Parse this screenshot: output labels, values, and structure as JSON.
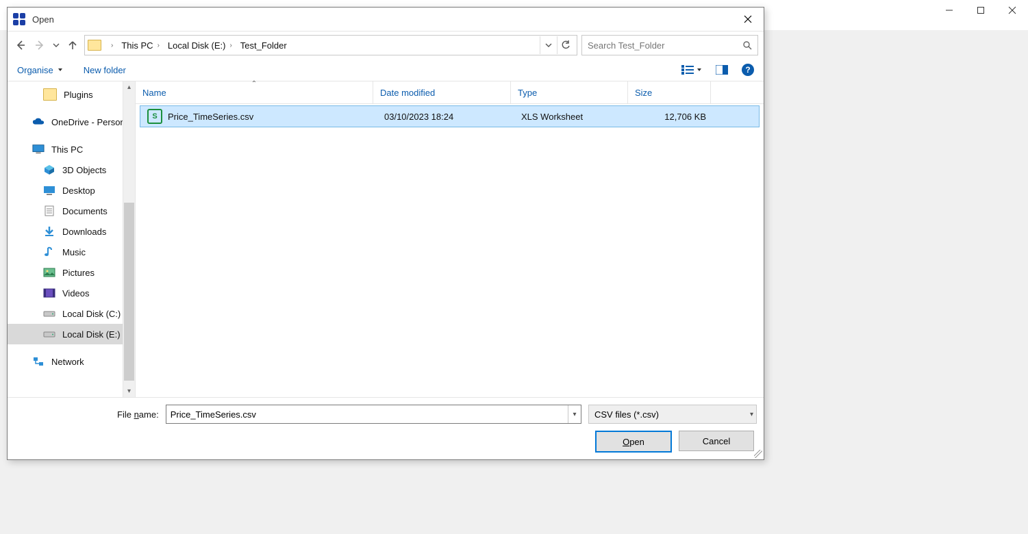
{
  "outer_window": {
    "controls": {
      "min": "–",
      "max": "▢",
      "close": "✕"
    }
  },
  "dialog": {
    "title": "Open",
    "close": "✕"
  },
  "breadcrumb": {
    "items": [
      "This PC",
      "Local Disk (E:)",
      "Test_Folder"
    ]
  },
  "search": {
    "placeholder": "Search Test_Folder"
  },
  "toolbar": {
    "organise": "Organise",
    "new_folder": "New folder"
  },
  "tree": {
    "items": [
      {
        "label": "Plugins",
        "level": 1,
        "icon": "folder"
      },
      {
        "label": "OneDrive - Personal",
        "level": 0,
        "icon": "cloud"
      },
      {
        "label": "This PC",
        "level": 0,
        "icon": "pc"
      },
      {
        "label": "3D Objects",
        "level": 1,
        "icon": "3d"
      },
      {
        "label": "Desktop",
        "level": 1,
        "icon": "desktop"
      },
      {
        "label": "Documents",
        "level": 1,
        "icon": "doc"
      },
      {
        "label": "Downloads",
        "level": 1,
        "icon": "down"
      },
      {
        "label": "Music",
        "level": 1,
        "icon": "music"
      },
      {
        "label": "Pictures",
        "level": 1,
        "icon": "pic"
      },
      {
        "label": "Videos",
        "level": 1,
        "icon": "vid"
      },
      {
        "label": "Local Disk (C:)",
        "level": 1,
        "icon": "disk"
      },
      {
        "label": "Local Disk (E:)",
        "level": 1,
        "icon": "disk",
        "selected": true
      },
      {
        "label": "Network",
        "level": 0,
        "icon": "net"
      }
    ]
  },
  "columns": {
    "name": "Name",
    "date": "Date modified",
    "type": "Type",
    "size": "Size"
  },
  "files": [
    {
      "name": "Price_TimeSeries.csv",
      "date": "03/10/2023 18:24",
      "type": "XLS Worksheet",
      "size": "12,706 KB",
      "icon_letter": "S",
      "selected": true
    }
  ],
  "bottom": {
    "file_name_label_pre": "File ",
    "file_name_label_u": "n",
    "file_name_label_post": "ame:",
    "file_name_value": "Price_TimeSeries.csv",
    "filter": "CSV files (*.csv)",
    "open_pre": "",
    "open_u": "O",
    "open_post": "pen",
    "cancel": "Cancel"
  }
}
